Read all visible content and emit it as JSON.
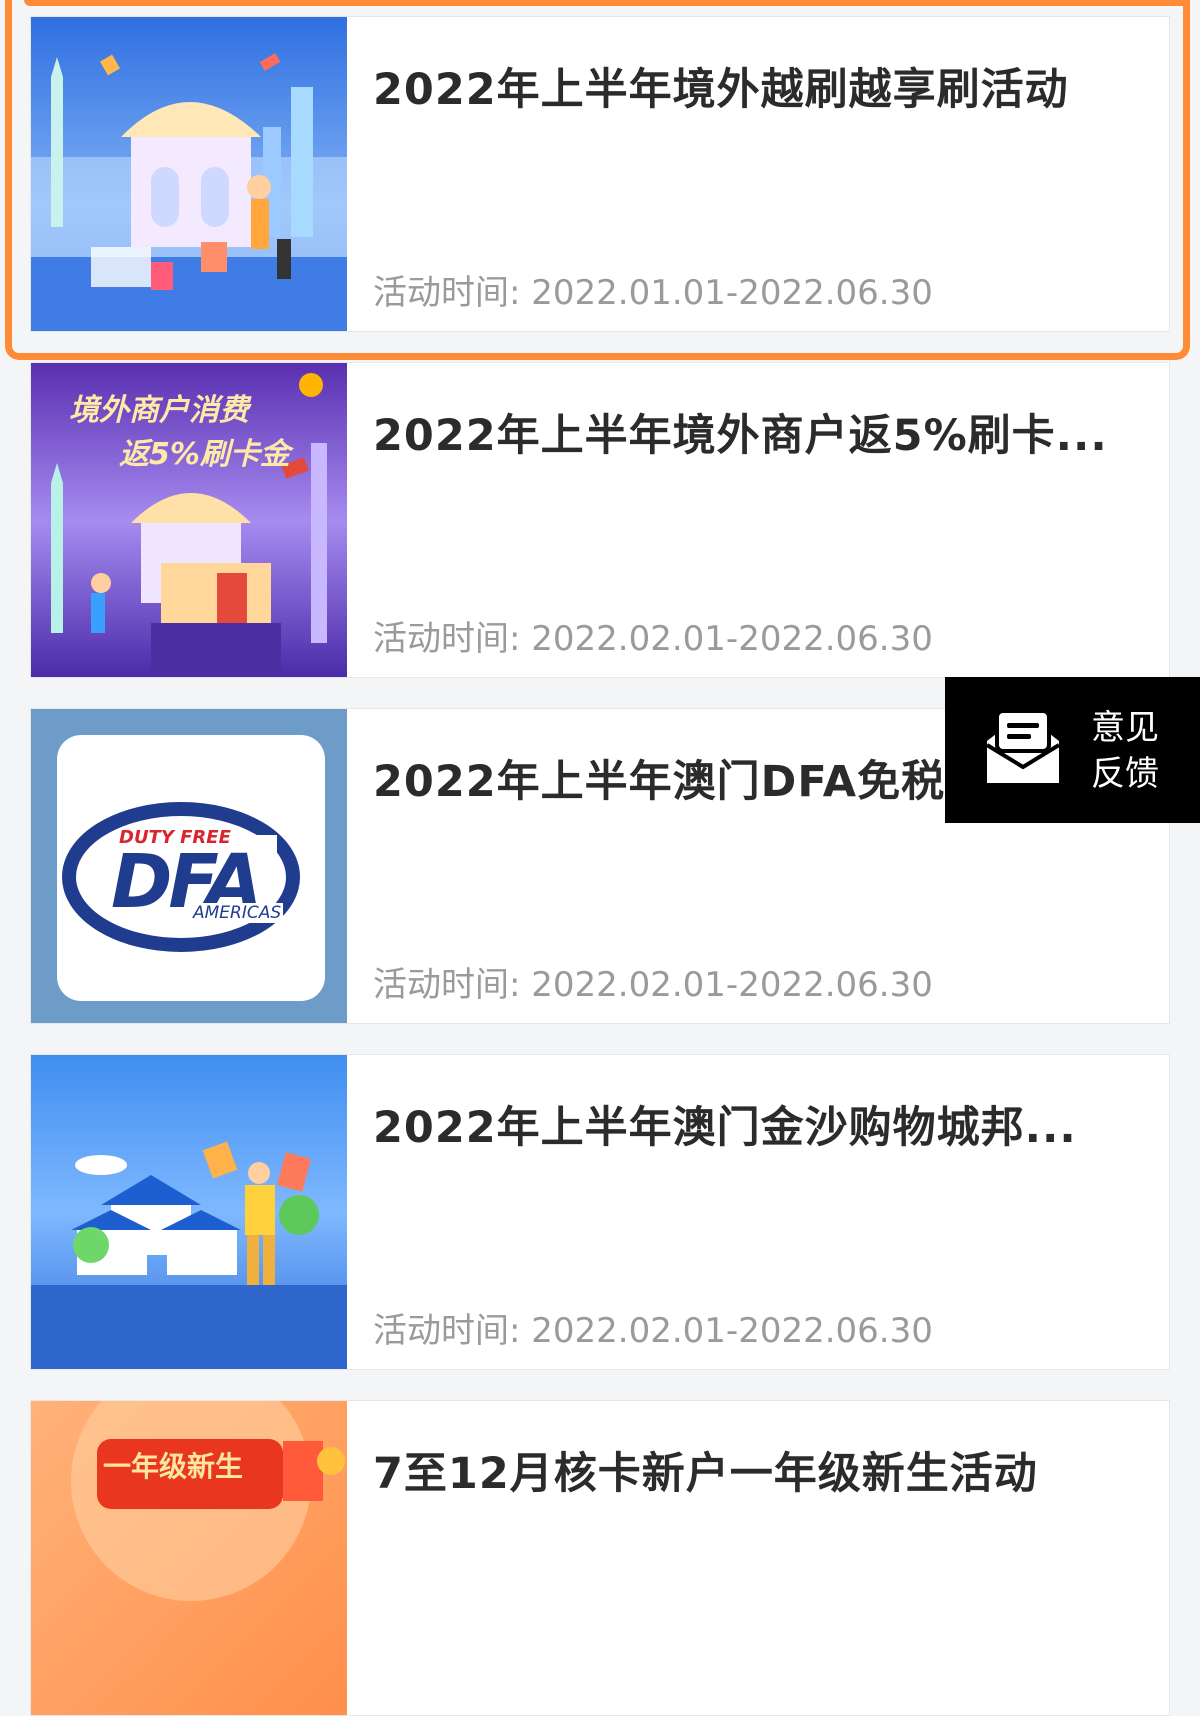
{
  "activities": [
    {
      "title": "2022年上半年境外越刷越享刷活动",
      "date_label": "活动时间: 2022.01.01-2022.06.30",
      "thumb_icon": "travel-shopping-illustration"
    },
    {
      "title": "2022年上半年境外商户返5%刷卡...",
      "date_label": "活动时间: 2022.02.01-2022.06.30",
      "thumb_icon": "cashback-gift-illustration",
      "thumb_text_1": "境外商户消费",
      "thumb_text_2": "返5%刷卡金"
    },
    {
      "title": "2022年上半年澳门DFA免税店...",
      "date_label": "活动时间: 2022.02.01-2022.06.30",
      "thumb_icon": "dfa-logo",
      "logo_small": "DUTY FREE",
      "logo_big": "DFA",
      "logo_sub": "AMERICAS"
    },
    {
      "title": "2022年上半年澳门金沙购物城邦...",
      "date_label": "活动时间: 2022.02.01-2022.06.30",
      "thumb_icon": "shopping-mall-illustration"
    },
    {
      "title": "7至12月核卡新户一年级新生活动",
      "date_label": "",
      "thumb_icon": "red-envelope-illustration",
      "thumb_text_1": "一年级新生"
    }
  ],
  "feedback": {
    "icon": "feedback-envelope-icon",
    "label_line1": "意见",
    "label_line2": "反馈"
  },
  "colors": {
    "highlight": "#ff8b37",
    "title": "#2b2b2b",
    "date": "#9a9a9a",
    "feedback_bg": "#000000"
  }
}
